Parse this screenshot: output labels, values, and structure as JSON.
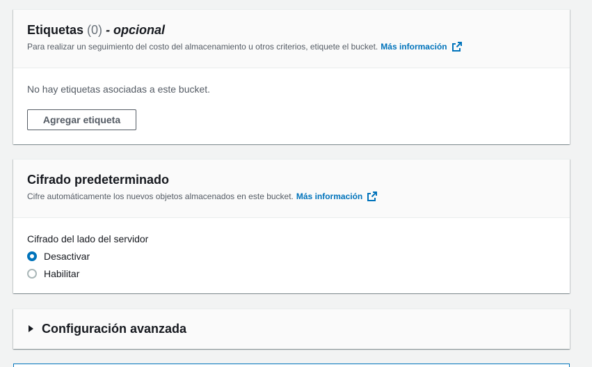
{
  "tags": {
    "title": "Etiquetas",
    "count": "(0)",
    "optional": "- opcional",
    "description": "Para realizar un seguimiento del costo del almacenamiento u otros criterios, etiquete el bucket.",
    "more_info": "Más información",
    "empty_text": "No hay etiquetas asociadas a este bucket.",
    "add_button": "Agregar etiqueta"
  },
  "encryption": {
    "title": "Cifrado predeterminado",
    "description": "Cifre automáticamente los nuevos objetos almacenados en este bucket.",
    "more_info": "Más información",
    "field_label": "Cifrado del lado del servidor",
    "options": [
      {
        "label": "Desactivar",
        "selected": true
      },
      {
        "label": "Habilitar",
        "selected": false
      }
    ]
  },
  "advanced": {
    "title": "Configuración avanzada",
    "expanded": false
  },
  "colors": {
    "link": "#0073bb",
    "background": "#f2f3f3",
    "text": "#16191f",
    "muted": "#545b64"
  },
  "icons": {
    "external_link": "external-link-icon",
    "caret": "caret-right-icon"
  }
}
